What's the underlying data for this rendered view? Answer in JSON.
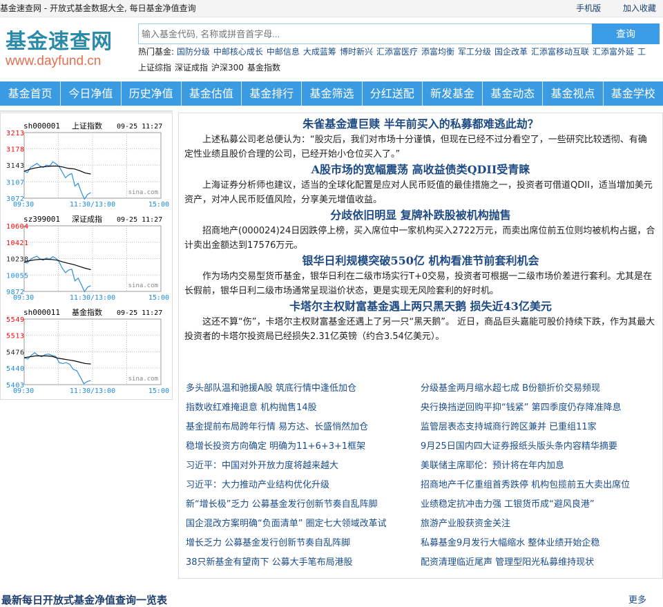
{
  "topbar": {
    "title": "基金速查网 - 开放式基金数据大全, 每日基金净值查询",
    "links": [
      "手机版",
      "加入收藏"
    ]
  },
  "logo": {
    "cn": "基金速查网",
    "en": "www.dayfund.cn"
  },
  "search": {
    "placeholder": "输入基金代码, 名称或拼音首字母...",
    "button": "查询"
  },
  "hot": {
    "label": "热门基金:",
    "items": [
      "国防分级",
      "中邮核心成长",
      "中邮信息",
      "大成蓝筹",
      "博时新兴",
      "汇添富医疗",
      "添富均衡",
      "军工分级",
      "国企改革",
      "汇添富移动互联",
      "汇添富外延",
      "工"
    ],
    "items2": [
      "上证综指",
      "深证成指",
      "沪深300",
      "基金指数"
    ]
  },
  "nav": [
    "基金首页",
    "今日净值",
    "历史净值",
    "基金估值",
    "基金排行",
    "基金筛选",
    "分红送配",
    "新发基金",
    "基金动态",
    "基金视点",
    "基金学校"
  ],
  "chart_data": [
    {
      "type": "line",
      "code": "sh000001",
      "title": "上证指数",
      "datetime": "09-25 11:27",
      "yticks": [
        3213,
        3178,
        3143,
        3107,
        3072
      ],
      "ylim": [
        3072,
        3213
      ],
      "xticks": [
        "09:30",
        "11:30/13:00",
        "15:00"
      ],
      "watermark": "sina.com",
      "grid": true,
      "series": [
        {
          "color": "#2a8ee0",
          "values": [
            3130,
            3127,
            3138,
            3142,
            3147,
            3141,
            3138,
            3143,
            3141,
            3150,
            3146,
            3140,
            3128,
            3116,
            3122,
            3125,
            3098,
            3104,
            3085,
            3070,
            3080,
            3084
          ]
        },
        {
          "color": "#000000",
          "values": [
            3130,
            3134,
            3137,
            3139,
            3140,
            3141,
            3141,
            3139,
            3136,
            3135,
            3131,
            3126,
            3124
          ]
        }
      ]
    },
    {
      "type": "line",
      "code": "sz399001",
      "title": "深证成指",
      "datetime": "09-25 11:27",
      "yticks": [
        10604,
        10421,
        10238,
        10055,
        9872
      ],
      "ylim": [
        9872,
        10604
      ],
      "xticks": [
        "09:30",
        "11:30/13:00",
        "15:00"
      ],
      "watermark": "sina.com",
      "grid": true,
      "series": [
        {
          "color": "#2a8ee0",
          "values": [
            10195,
            10190,
            10230,
            10250,
            10265,
            10235,
            10220,
            10245,
            10230,
            10260,
            10240,
            10200,
            10130,
            10080,
            10110,
            10120,
            9990,
            10020,
            9950,
            9870,
            9920,
            9935
          ]
        },
        {
          "color": "#000000",
          "values": [
            10200,
            10215,
            10225,
            10230,
            10230,
            10228,
            10220,
            10200,
            10185,
            10170,
            10150,
            10130,
            10115
          ]
        }
      ]
    },
    {
      "type": "line",
      "code": "sh000011",
      "title": "基金指数",
      "datetime": "09-25 11:27",
      "yticks": [
        5549,
        5513,
        5476,
        5440,
        5403
      ],
      "ylim": [
        5403,
        5549
      ],
      "xticks": [
        "09:30",
        "11:30/13:00",
        "15:00"
      ],
      "watermark": "sina.com",
      "grid": true,
      "series": [
        {
          "color": "#2a8ee0",
          "values": [
            5463,
            5460,
            5468,
            5474,
            5468,
            5465,
            5470,
            5471,
            5468,
            5466,
            5452,
            5450,
            5452,
            5448,
            5437,
            5434,
            5420,
            5405,
            5410,
            5412
          ]
        },
        {
          "color": "#000000",
          "values": [
            5463,
            5465,
            5467,
            5467,
            5467,
            5466,
            5462,
            5460,
            5458,
            5456,
            5453,
            5450,
            5449
          ]
        }
      ]
    }
  ],
  "articles": [
    {
      "title": "朱雀基金遭巨赎 半年前买入的私募都难逃此劫？",
      "body": "上述私募公司老总便认为：“股灾后，我们对市场十分谨慎，但现在已经不过分看空了，一些研究比较透彻、有确定性业绩且股价合理的公司，已经开始小仓位买入了。”"
    },
    {
      "title": "A股市场的宽幅震荡 高收益债类QDII受青睐",
      "body": "上海证券分析师也建议，适当的全球化配置是应对人民币贬值的最佳措施之一，投资者可借道QDII，适当增加美元资产，对冲人民币贬值风险，分享美元增值收益。"
    },
    {
      "title": "分歧依旧明显 复牌补跌股被机构抛售",
      "body": "招商地产(000024)24日因跌停上榜，买入席位中一家机构买入2722万元，而卖出席位前五位则均被机构占据，合计卖出金额达到17576万元。"
    },
    {
      "title": "银华日利规模突破550亿 机构看准节前套利机会",
      "body": "作为场内交易型货币基金，银华日利在二级市场实行T+0交易，投资者可根据一二级市场价差进行套利。尤其是在长假前，银华日利二级市场通常呈现溢价状态，更是实现无风险套利的好时机。"
    },
    {
      "title": "卡塔尔主权财富基金遇上两只黑天鹅 损失近43亿美元",
      "body": "这还不算“伤”，卡塔尔主权财富基金还遇上了另一只“黑天鹅”。 近日，商品巨头嘉能可股价持续下跌，作为其最大投资者的卡塔尔投资局已经损失2.31亿英镑（约合3.54亿美元）。"
    }
  ],
  "news": [
    "多头部队温和驰援A股 筑底行情中逢低加仓",
    "分级基金两月缩水超七成 B份额折价交易频现",
    "指数收红难掩退意 机构抛售14股",
    "央行换挡逆回购平抑“钱紧” 第四季度仍存降准降息",
    "基金提前布局跨年行情 易方达、长盛悄然加仓",
    "监管层表态支持城商行跨区兼并 已重组11家",
    "稳增长投资方向确定 明确为11+6+3+1框架",
    "9月25日国内四大证券报纸头版头条内容精华摘要",
    "习近平：中国对外开放力度将越来越大",
    "美联储主席耶伦：预计将在年内加息",
    "习近平：大力推动产业结构优化升级",
    "招商地产千亿重组首秀跌停 机构包揽前五大卖出席位",
    "新“增长极”乏力 公募基金发行创新节奏自乱阵脚",
    "业绩稳定抗冲击力强 工银货币成“避风良港”",
    "国企混改方案明确“负面清单” 圈定七大领域改革试",
    "旅游产业股获资金关注",
    "增长乏力 公募基金发行创新节奏自乱阵脚",
    "私募基金9月发行大幅缩水 整体业绩开始企稳",
    "38只新基金有望南下 公募大手笔布局港股",
    "配资清理临近尾声 管理型阳光私募维持现状"
  ],
  "bottom": {
    "title": "最新每日开放式基金净值查询一览表",
    "more": "更多"
  }
}
